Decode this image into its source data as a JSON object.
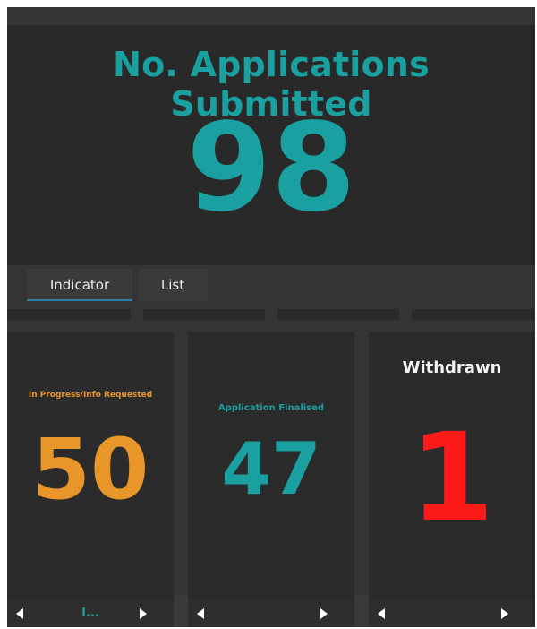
{
  "top": {
    "title": "No. Applications Submitted",
    "value": "98"
  },
  "tabs": [
    {
      "label": "Indicator",
      "active": true
    },
    {
      "label": "List",
      "active": false
    }
  ],
  "cards": [
    {
      "title": "In Progress/Info Requested",
      "value": "50",
      "color": "#e8962a",
      "footer_label": "I..."
    },
    {
      "title": "Application Finalised",
      "value": "47",
      "color": "#1aa0a0",
      "footer_label": ""
    },
    {
      "title": "Withdrawn",
      "value": "1",
      "color": "#ff1a1a",
      "footer_label": ""
    }
  ],
  "colors": {
    "accent": "#1aa0a0",
    "tab_underline": "#2e7fa7",
    "background": "#292929"
  },
  "icons": {
    "prev": "chevron-left-icon",
    "next": "chevron-right-icon"
  }
}
